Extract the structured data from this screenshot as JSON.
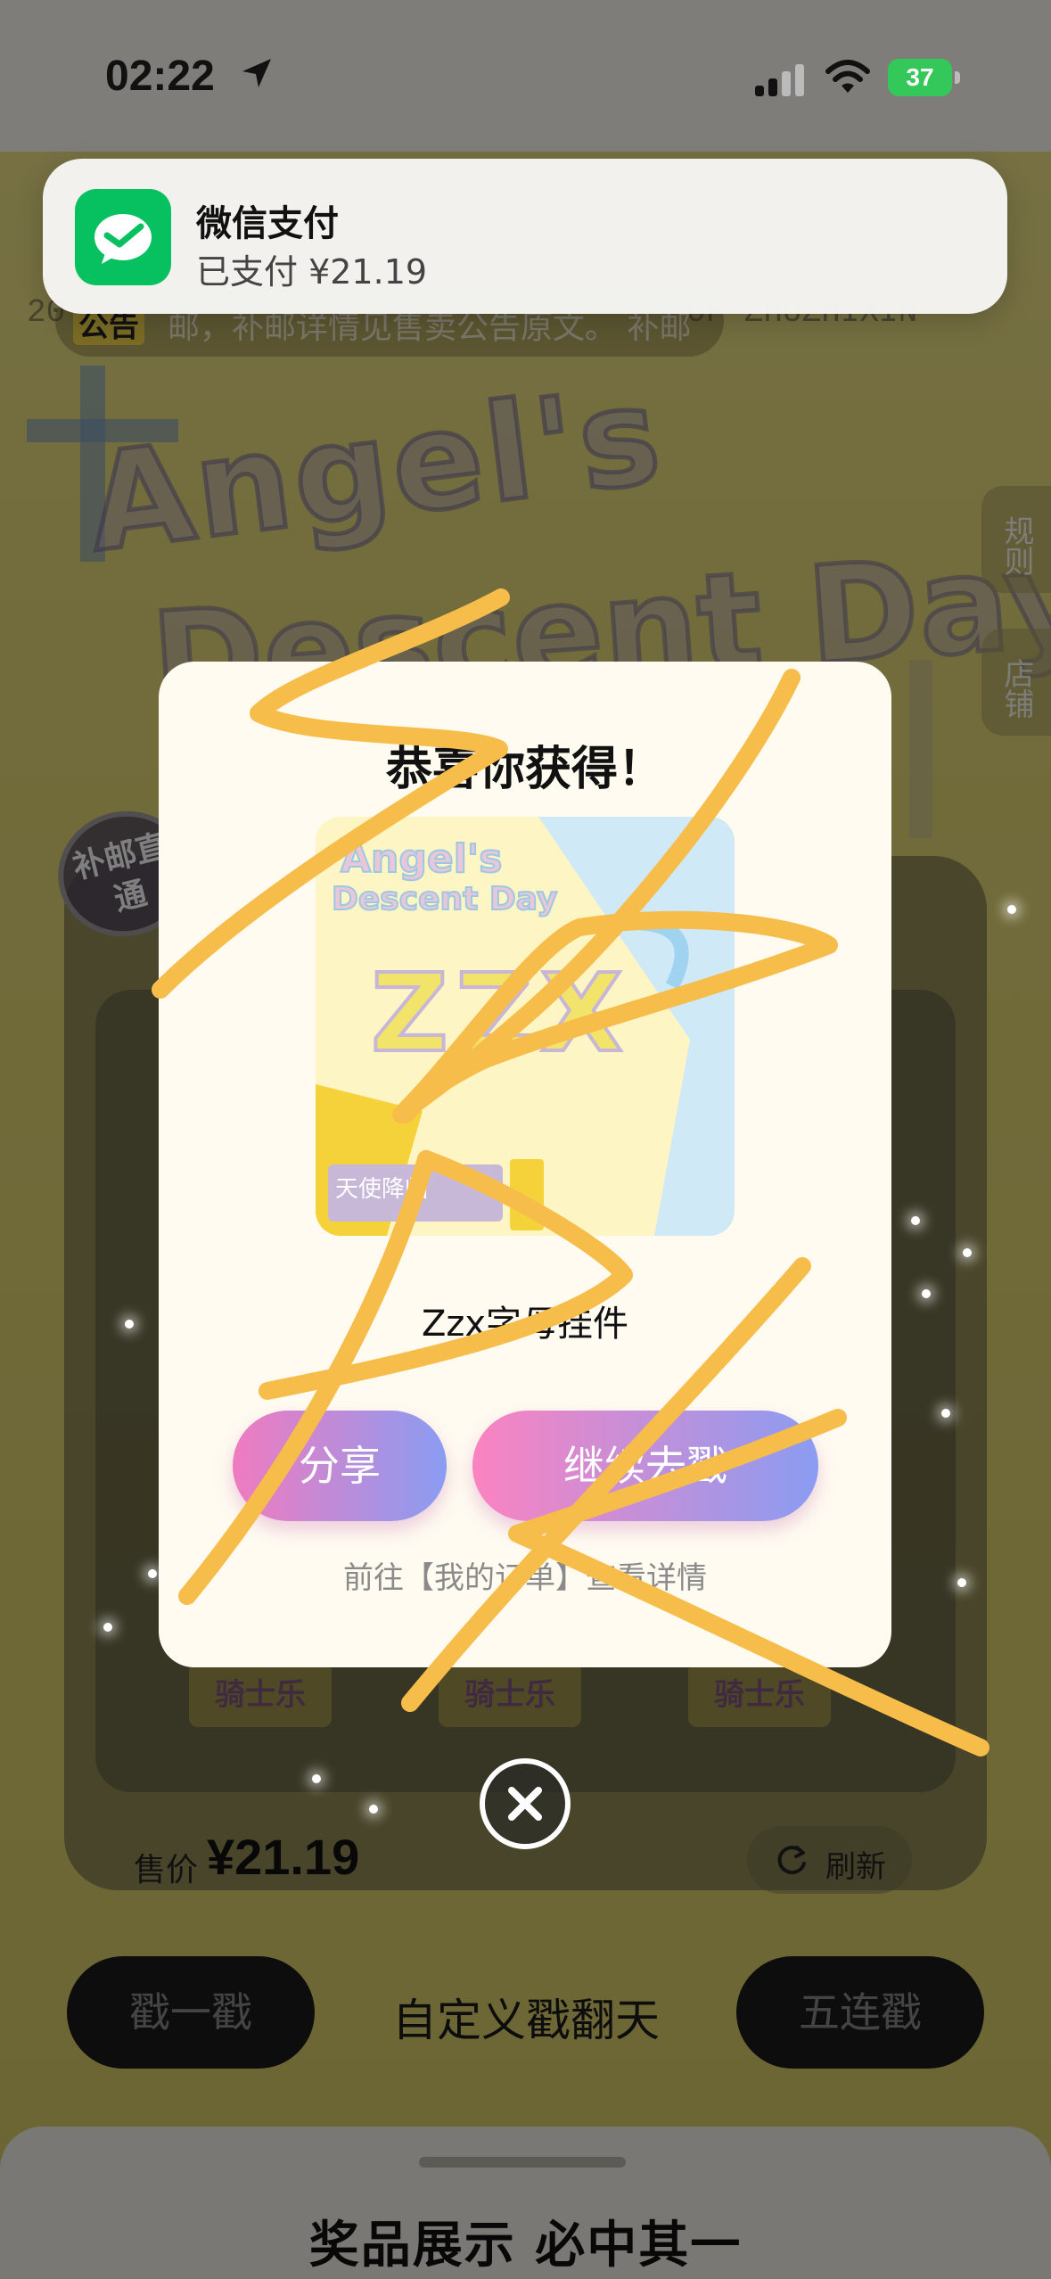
{
  "status_bar": {
    "time": "02:22",
    "battery": "37",
    "icons": [
      "location-arrow-icon",
      "cellular-signal-icon",
      "wifi-icon",
      "battery-charging-icon"
    ]
  },
  "notification": {
    "app_icon": "wechat-pay-icon",
    "title": "微信支付",
    "body": "已支付 ¥21.19"
  },
  "background": {
    "notice_tag": "公告",
    "notice_text": "邮，补邮详情见售卖公告原文。 补邮",
    "side_text_left": "20",
    "side_text_right": "OF ZHUZHIXIN",
    "banner_line1": "Angel's",
    "banner_line2": "Descent Day",
    "side_buttons": [
      "规则",
      "店铺"
    ],
    "stamp": "补邮直通",
    "capsule_label": "骑士乐",
    "price_label": "售价",
    "price_value": "¥21.19",
    "refresh_label": "刷新",
    "btn_single": "戳一戳",
    "custom_label": "自定义戳翻天",
    "btn_five": "五连戳",
    "prize_section_title": "奖品展示 必中其一"
  },
  "modal": {
    "title": "恭喜你获得！",
    "prize_image": {
      "line1": "Angel's",
      "line2": "Descent Day",
      "letters": "ZZX",
      "tag": "天使降临"
    },
    "prize_name": "Zzx字母挂件",
    "share_label": "分享",
    "continue_label": "继续去戳",
    "orders_link": "前往【我的订单】查看详情",
    "close_icon": "close-icon"
  },
  "colors": {
    "wechat_green": "#07c160",
    "battery_green": "#34c759",
    "button_gradient_start": "#f07bbf",
    "button_gradient_end": "#8a9cf2",
    "scribble": "#f7bd4a"
  }
}
